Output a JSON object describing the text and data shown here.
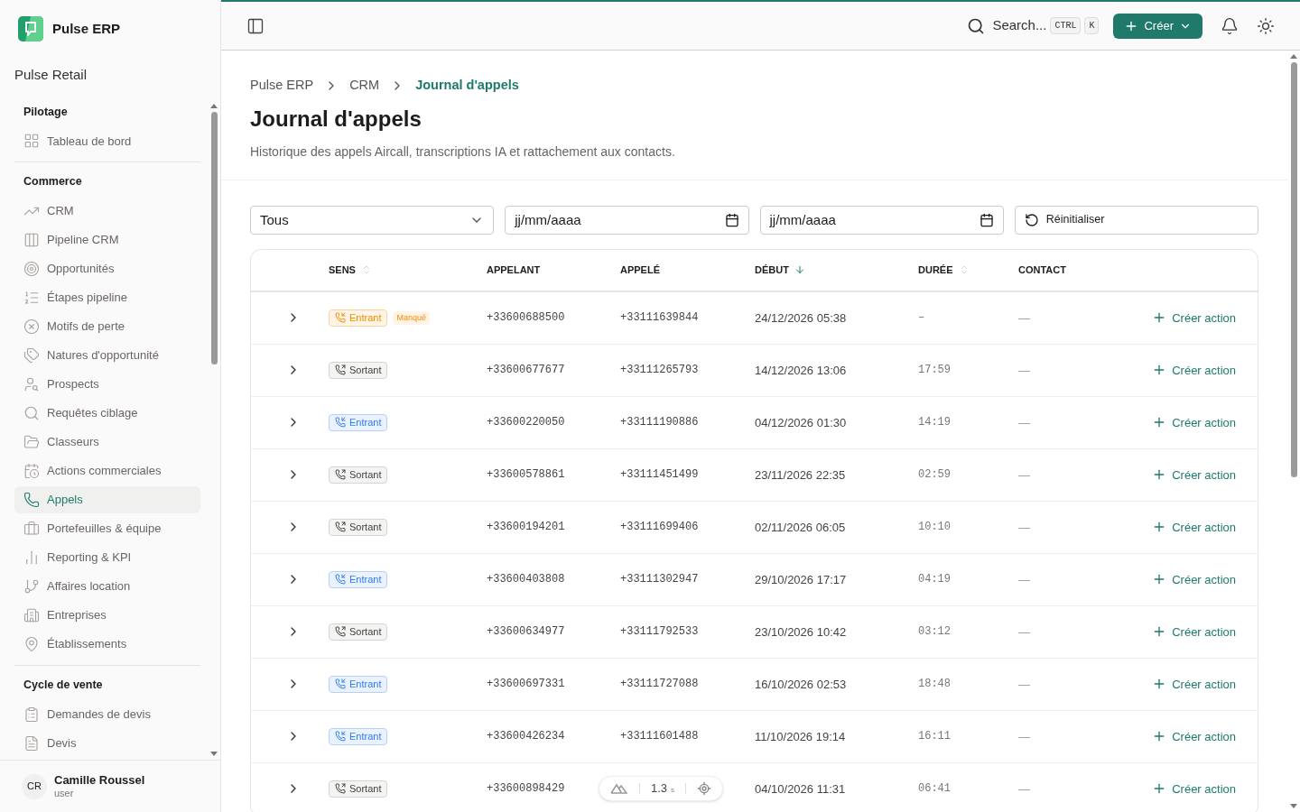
{
  "app": {
    "name": "Pulse ERP",
    "workspace": "Pulse Retail"
  },
  "sidebar": {
    "groups": [
      {
        "title": "Pilotage",
        "items": [
          {
            "label": "Tableau de bord",
            "selected": false
          }
        ]
      },
      {
        "title": "Commerce",
        "items": [
          {
            "label": "CRM",
            "selected": false
          },
          {
            "label": "Pipeline CRM",
            "selected": false
          },
          {
            "label": "Opportunités",
            "selected": false
          },
          {
            "label": "Étapes pipeline",
            "selected": false
          },
          {
            "label": "Motifs de perte",
            "selected": false
          },
          {
            "label": "Natures d'opportunité",
            "selected": false
          },
          {
            "label": "Prospects",
            "selected": false
          },
          {
            "label": "Requêtes ciblage",
            "selected": false
          },
          {
            "label": "Classeurs",
            "selected": false
          },
          {
            "label": "Actions commerciales",
            "selected": false
          },
          {
            "label": "Appels",
            "selected": true
          },
          {
            "label": "Portefeuilles & équipe",
            "selected": false
          },
          {
            "label": "Reporting & KPI",
            "selected": false
          },
          {
            "label": "Affaires location",
            "selected": false
          },
          {
            "label": "Entreprises",
            "selected": false
          },
          {
            "label": "Établissements",
            "selected": false
          }
        ]
      },
      {
        "title": "Cycle de vente",
        "items": [
          {
            "label": "Demandes de devis",
            "selected": false
          },
          {
            "label": "Devis",
            "selected": false
          }
        ]
      }
    ],
    "user": {
      "initials": "CR",
      "name": "Camille Roussel",
      "role": "user"
    }
  },
  "topbar": {
    "search": "Search...",
    "shortcut": [
      "CTRL",
      "K"
    ],
    "create": "Créer"
  },
  "breadcrumb": [
    "Pulse ERP",
    "CRM",
    "Journal d'appels"
  ],
  "page": {
    "title": "Journal d'appels",
    "subtitle": "Historique des appels Aircall, transcriptions IA et rattachement aux contacts."
  },
  "filters": {
    "direction": "Tous",
    "date_from": "jj/mm/aaaa",
    "date_to": "jj/mm/aaaa",
    "reset": "Réinitialiser"
  },
  "table": {
    "columns": [
      {
        "label": "SENS",
        "sortable": true,
        "sorted": false
      },
      {
        "label": "APPELANT"
      },
      {
        "label": "APPELÉ"
      },
      {
        "label": "DÉBUT",
        "sortable": true,
        "sorted": true
      },
      {
        "label": "DURÉE",
        "sortable": true,
        "sorted": false
      },
      {
        "label": "CONTACT"
      }
    ],
    "rows": [
      {
        "kind": "in",
        "direction": "Entrant",
        "missed": true,
        "missed_label": "Manqué",
        "caller": "+33600688500",
        "callee": "+33111639844",
        "start": "24/12/2026 05:38",
        "duration": "–",
        "contact": "—",
        "action": "Créer action"
      },
      {
        "kind": "out",
        "direction": "Sortant",
        "missed": false,
        "caller": "+33600677677",
        "callee": "+33111265793",
        "start": "14/12/2026 13:06",
        "duration": "17:59",
        "contact": "—",
        "action": "Créer action"
      },
      {
        "kind": "in",
        "direction": "Entrant",
        "missed": false,
        "caller": "+33600220050",
        "callee": "+33111190886",
        "start": "04/12/2026 01:30",
        "duration": "14:19",
        "contact": "—",
        "action": "Créer action"
      },
      {
        "kind": "out",
        "direction": "Sortant",
        "missed": false,
        "caller": "+33600578861",
        "callee": "+33111451499",
        "start": "23/11/2026 22:35",
        "duration": "02:59",
        "contact": "—",
        "action": "Créer action"
      },
      {
        "kind": "out",
        "direction": "Sortant",
        "missed": false,
        "caller": "+33600194201",
        "callee": "+33111699406",
        "start": "02/11/2026 06:05",
        "duration": "10:10",
        "contact": "—",
        "action": "Créer action"
      },
      {
        "kind": "in",
        "direction": "Entrant",
        "missed": false,
        "caller": "+33600403808",
        "callee": "+33111302947",
        "start": "29/10/2026 17:17",
        "duration": "04:19",
        "contact": "—",
        "action": "Créer action"
      },
      {
        "kind": "out",
        "direction": "Sortant",
        "missed": false,
        "caller": "+33600634977",
        "callee": "+33111792533",
        "start": "23/10/2026 10:42",
        "duration": "03:12",
        "contact": "—",
        "action": "Créer action"
      },
      {
        "kind": "in",
        "direction": "Entrant",
        "missed": false,
        "caller": "+33600697331",
        "callee": "+33111727088",
        "start": "16/10/2026 02:53",
        "duration": "18:48",
        "contact": "—",
        "action": "Créer action"
      },
      {
        "kind": "in",
        "direction": "Entrant",
        "missed": false,
        "caller": "+33600426234",
        "callee": "+33111601488",
        "start": "11/10/2026 19:14",
        "duration": "16:11",
        "contact": "—",
        "action": "Créer action"
      },
      {
        "kind": "out",
        "direction": "Sortant",
        "missed": false,
        "caller": "+33600898429",
        "start": "04/10/2026 11:31",
        "duration": "06:41",
        "contact": "—",
        "action": "Créer action"
      }
    ]
  },
  "dev_pill": {
    "value": "1.3",
    "unit": "s"
  }
}
